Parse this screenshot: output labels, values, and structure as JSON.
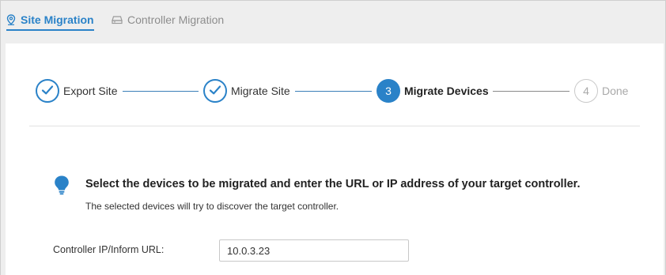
{
  "tabs": [
    {
      "label": "Site Migration",
      "icon": "location-pin-icon",
      "active": true
    },
    {
      "label": "Controller Migration",
      "icon": "controller-device-icon",
      "active": false
    }
  ],
  "steps": [
    {
      "number": "1",
      "label": "Export Site",
      "state": "done"
    },
    {
      "number": "2",
      "label": "Migrate Site",
      "state": "done"
    },
    {
      "number": "3",
      "label": "Migrate Devices",
      "state": "current"
    },
    {
      "number": "4",
      "label": "Done",
      "state": "todo"
    }
  ],
  "tip": {
    "icon": "lightbulb-icon",
    "title": "Select the devices to be migrated and enter the URL or IP address of your target controller.",
    "subtitle": "The selected devices will try to discover the target controller."
  },
  "form": {
    "controller_label": "Controller IP/Inform URL:",
    "controller_value": "10.0.3.23"
  },
  "colors": {
    "accent": "#2a82c8",
    "page_bg": "#eeeeee",
    "card_bg": "#ffffff",
    "inactive": "#a9a9a9"
  }
}
